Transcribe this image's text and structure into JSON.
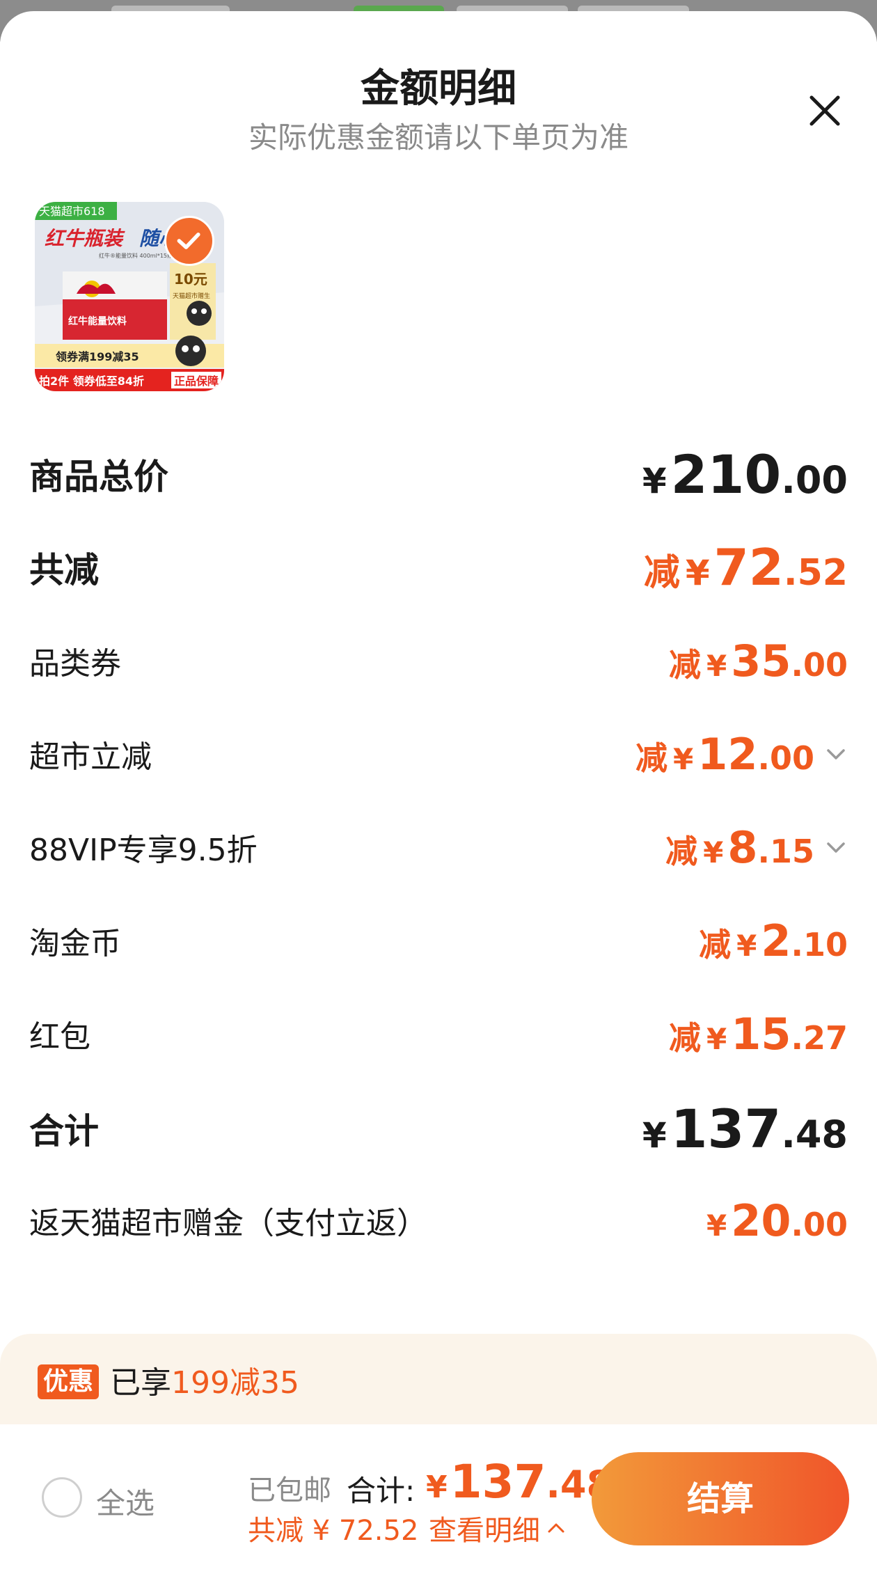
{
  "sheet": {
    "title": "金额明细",
    "subtitle": "实际优惠金额请以下单页为准",
    "close_icon": "close-icon"
  },
  "product": {
    "banner_tag": "天猫超市618",
    "banner_title": "红牛瓶装",
    "banner_title2": "随心",
    "spec": "红牛®能量饮料 400ml*15瓶",
    "box_text": "红牛能量饮料",
    "side_price": "10元",
    "side_note": "天猫超市赠生",
    "coupon_text": "领券满199减35",
    "bottom_text": "拍2件 领券低至84折",
    "guarantee": "正品保障",
    "selected": true
  },
  "rows": [
    {
      "label": "商品总价",
      "prefix": "",
      "currency": "¥",
      "int": "210",
      "dec": ".00"
    },
    {
      "label": "共减",
      "prefix": "减",
      "currency": "¥",
      "int": "72",
      "dec": ".52"
    },
    {
      "label": "品类券",
      "prefix": "减",
      "currency": "¥",
      "int": "35",
      "dec": ".00"
    },
    {
      "label": "超市立减",
      "prefix": "减",
      "currency": "¥",
      "int": "12",
      "dec": ".00",
      "expandable": true
    },
    {
      "label": "88VIP专享9.5折",
      "prefix": "减",
      "currency": "¥",
      "int": "8",
      "dec": ".15",
      "expandable": true
    },
    {
      "label": "淘金币",
      "prefix": "减",
      "currency": "¥",
      "int": "2",
      "dec": ".10"
    },
    {
      "label": "红包",
      "prefix": "减",
      "currency": "¥",
      "int": "15",
      "dec": ".27"
    },
    {
      "label": "合计",
      "prefix": "",
      "currency": "¥",
      "int": "137",
      "dec": ".48"
    },
    {
      "label": "返天猫超市赠金（支付立返）",
      "prefix": "",
      "currency": "¥",
      "int": "20",
      "dec": ".00"
    }
  ],
  "promo": {
    "tag": "优惠",
    "text_prefix": "已享",
    "text_highlight": "199减35"
  },
  "footer": {
    "select_all": "全选",
    "shipping": "已包邮",
    "total_label": "合计:",
    "total_currency": "¥",
    "total_int": "137",
    "total_dec": ".48",
    "saving": "共减 ¥ 72.52",
    "view_detail": "查看明细",
    "checkout": "结算"
  },
  "colors": {
    "accent": "#f05a1e",
    "text": "#1a1a1a",
    "muted": "#8a8a8a",
    "promo_bg": "#fbf4ea"
  }
}
